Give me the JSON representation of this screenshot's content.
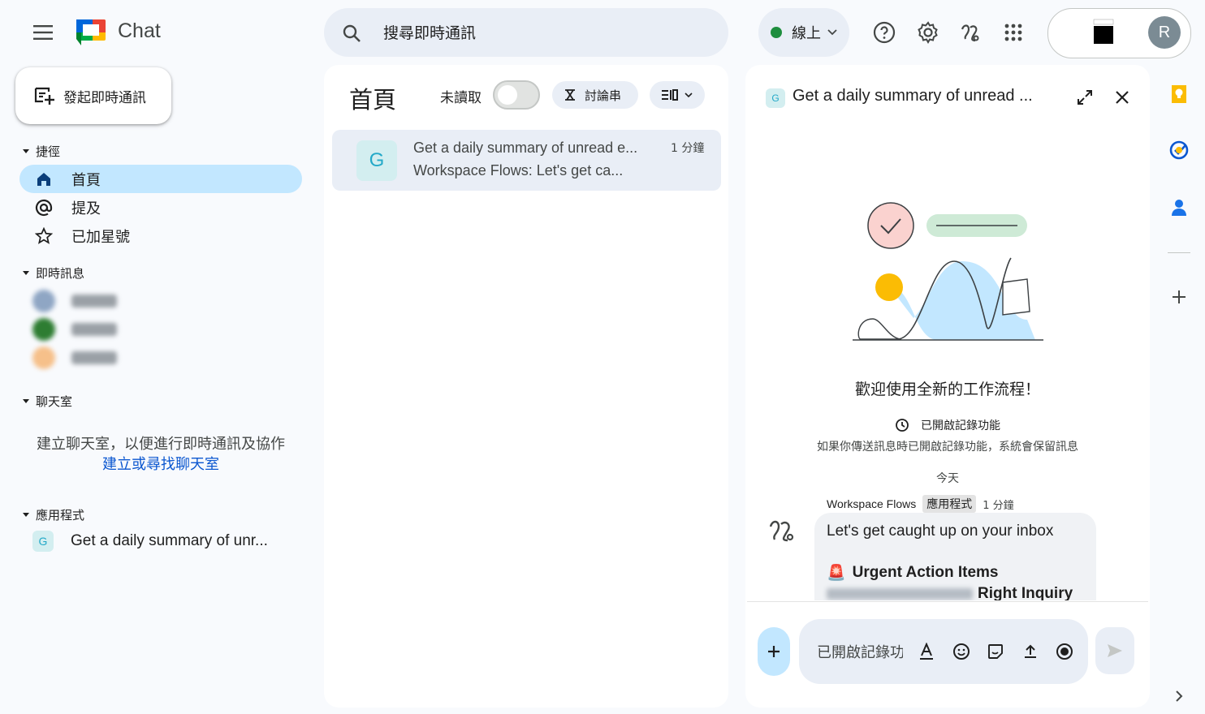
{
  "header": {
    "app_name": "Chat",
    "search_placeholder": "搜尋即時通訊",
    "status_label": "線上",
    "avatar_letter": "R"
  },
  "sidebar": {
    "new_chat_label": "發起即時通訊",
    "shortcuts_title": "捷徑",
    "shortcuts": [
      {
        "label": "首頁",
        "icon": "home-icon"
      },
      {
        "label": "提及",
        "icon": "at-icon"
      },
      {
        "label": "已加星號",
        "icon": "star-icon"
      }
    ],
    "dm_title": "即時訊息",
    "spaces_title": "聊天室",
    "spaces_hint": "建立聊天室，以便進行即時通訊及協作",
    "spaces_link": "建立或尋找聊天室",
    "apps_title": "應用程式",
    "apps": [
      {
        "badge": "G",
        "label": "Get a daily summary of unr..."
      }
    ]
  },
  "home": {
    "title": "首頁",
    "unread_label": "未讀取",
    "threads_label": "討論串",
    "conversations": [
      {
        "avatar": "G",
        "title": "Get a daily summary of unread e...",
        "snippet": "Workspace Flows: Let's get ca...",
        "time": "1 分鐘"
      }
    ]
  },
  "detail": {
    "badge": "G",
    "title": "Get a daily summary of unread ...",
    "welcome": "歡迎使用全新的工作流程！",
    "history_title": "已開啟記錄功能",
    "history_desc": "如果你傳送訊息時已開啟記錄功能，系統會保留訊息",
    "today_label": "今天",
    "message": {
      "sender": "Workspace Flows",
      "tag": "應用程式",
      "time": "1 分鐘",
      "line1": "Let's get caught up on your inbox",
      "line2_emoji": "🚨",
      "line2": "Urgent Action Items",
      "line3": "Right Inquiry"
    },
    "composer_placeholder": "已開啟記錄功能"
  },
  "colors": {
    "accent": "#0b57d0",
    "active_nav": "#c2e7ff",
    "online": "#1e8e3e"
  }
}
